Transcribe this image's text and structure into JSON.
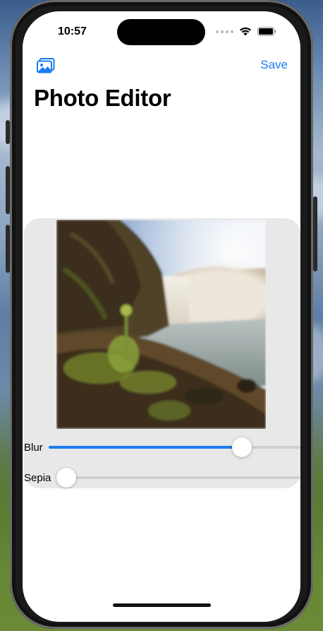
{
  "status_bar": {
    "time": "10:57"
  },
  "header": {
    "save_label": "Save",
    "title": "Photo Editor"
  },
  "controls": {
    "blur": {
      "label": "Blur",
      "value": 0.79
    },
    "sepia": {
      "label": "Sepia",
      "value": 0.0
    }
  },
  "colors": {
    "accent": "#1a7cf0",
    "panel": "#e8e8e8"
  },
  "icons": {
    "photo_library": "photo-library-icon",
    "wifi": "wifi-icon",
    "battery": "battery-icon"
  }
}
